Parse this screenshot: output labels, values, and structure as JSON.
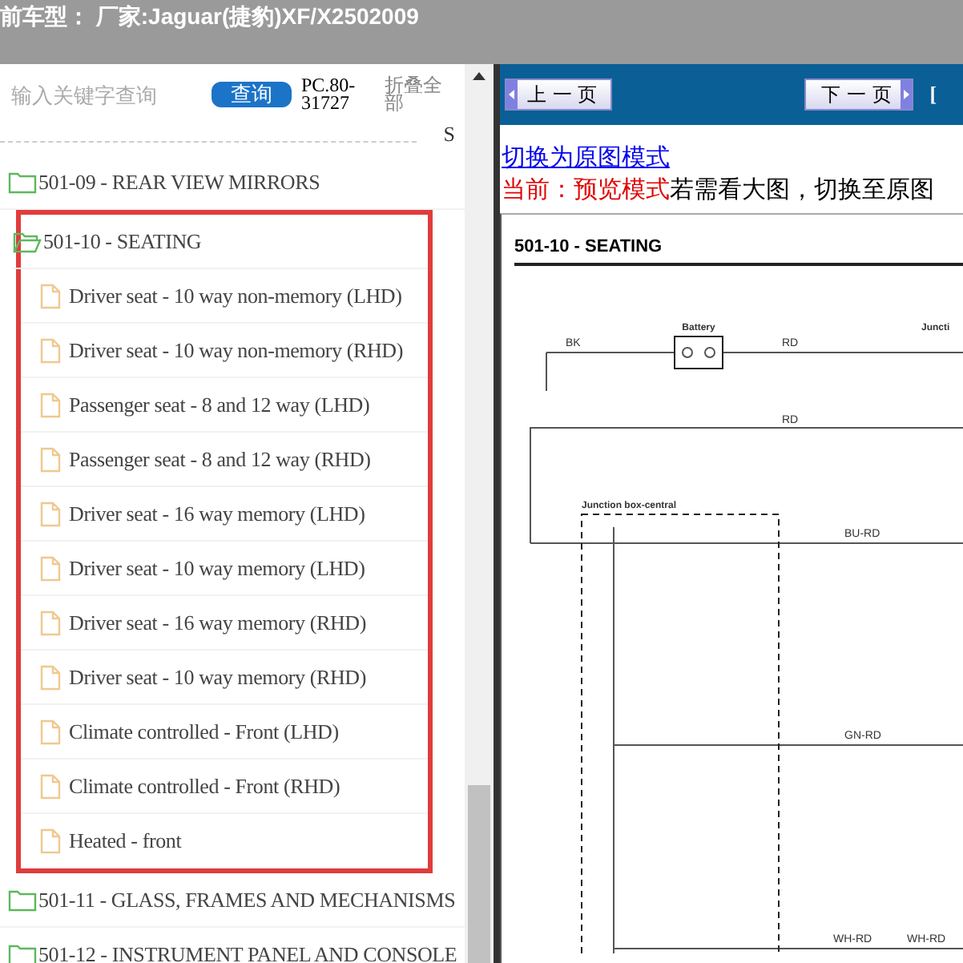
{
  "header": {
    "title": "前车型： 厂家:Jaguar(捷豹)XF/X2502009"
  },
  "search": {
    "placeholder": "输入关键字查询",
    "button": "查询",
    "code": "PC.80-31727",
    "collapse": "折叠全部",
    "clipped_row": "S"
  },
  "tree": [
    {
      "label": "501-09 - REAR VIEW MIRRORS",
      "expanded": false,
      "highlighted": false
    },
    {
      "label": "501-10 - SEATING",
      "expanded": true,
      "highlighted": true,
      "children": [
        {
          "label": "Driver seat - 10 way non-memory (LHD)"
        },
        {
          "label": "Driver seat - 10 way non-memory (RHD)"
        },
        {
          "label": "Passenger seat - 8 and 12 way (LHD)"
        },
        {
          "label": "Passenger seat - 8 and 12 way (RHD)"
        },
        {
          "label": "Driver seat - 16 way memory (LHD)"
        },
        {
          "label": "Driver seat - 10 way memory (LHD)"
        },
        {
          "label": "Driver seat - 16 way memory (RHD)"
        },
        {
          "label": "Driver seat - 10 way memory (RHD)"
        },
        {
          "label": "Climate controlled - Front (LHD)"
        },
        {
          "label": "Climate controlled - Front (RHD)"
        },
        {
          "label": "Heated - front"
        }
      ]
    },
    {
      "label": "501-11 - GLASS, FRAMES AND MECHANISMS",
      "expanded": false,
      "highlighted": false
    },
    {
      "label": "501-12 - INSTRUMENT PANEL AND CONSOLE",
      "expanded": false,
      "highlighted": false
    }
  ],
  "toolbar": {
    "prev": "上 一 页",
    "next": "下 一 页",
    "clipped": "["
  },
  "mode_link": "切换为原图模式",
  "notice": {
    "label": "当前：预览模式",
    "text": "若需看大图，切换至原图"
  },
  "diagram": {
    "title": "501-10 - SEATING",
    "labels": [
      "Battery",
      "BK",
      "RD",
      "Juncti",
      "RD",
      "Junction box-central",
      "BU-RD",
      "GN-RD",
      "WH-RD",
      "WH-RD"
    ]
  }
}
